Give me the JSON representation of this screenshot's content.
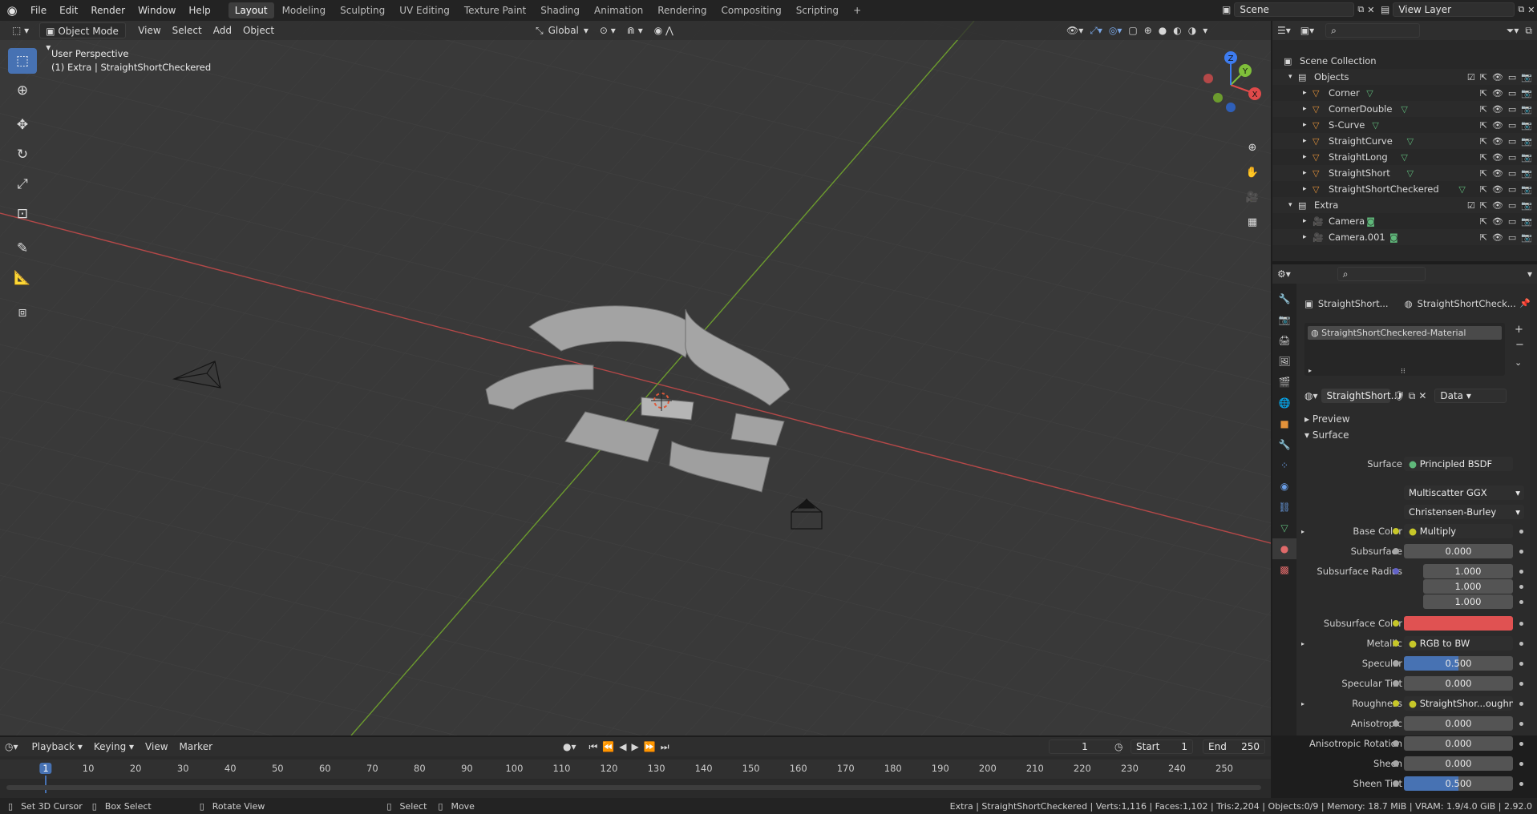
{
  "topbar": {
    "menus": [
      "File",
      "Edit",
      "Render",
      "Window",
      "Help"
    ],
    "workspaces": [
      "Layout",
      "Modeling",
      "Sculpting",
      "UV Editing",
      "Texture Paint",
      "Shading",
      "Animation",
      "Rendering",
      "Compositing",
      "Scripting"
    ],
    "active_workspace": "Layout",
    "add_workspace": "+",
    "scene": "Scene",
    "view_layer": "View Layer"
  },
  "viewport": {
    "mode": "Object Mode",
    "menus": [
      "View",
      "Select",
      "Add",
      "Object"
    ],
    "transform_orientation": "Global",
    "view_name": "User Perspective",
    "collection_object": "(1) Extra | StraightShortCheckered",
    "gizmo_axes": {
      "x": "X",
      "y": "Y",
      "z": "Z"
    }
  },
  "outliner": {
    "search_placeholder": "",
    "rows": [
      {
        "label": "Scene Collection",
        "indent": 0,
        "kind": "scene"
      },
      {
        "label": "Objects",
        "indent": 1,
        "kind": "collection"
      },
      {
        "label": "Corner",
        "indent": 2,
        "kind": "mesh"
      },
      {
        "label": "CornerDouble",
        "indent": 2,
        "kind": "mesh"
      },
      {
        "label": "S-Curve",
        "indent": 2,
        "kind": "mesh"
      },
      {
        "label": "StraightCurve",
        "indent": 2,
        "kind": "mesh"
      },
      {
        "label": "StraightLong",
        "indent": 2,
        "kind": "mesh"
      },
      {
        "label": "StraightShort",
        "indent": 2,
        "kind": "mesh"
      },
      {
        "label": "StraightShortCheckered",
        "indent": 2,
        "kind": "mesh"
      },
      {
        "label": "Extra",
        "indent": 1,
        "kind": "collection"
      },
      {
        "label": "Camera",
        "indent": 2,
        "kind": "camera"
      },
      {
        "label": "Camera.001",
        "indent": 2,
        "kind": "camera"
      }
    ]
  },
  "properties": {
    "breadcrumb_object": "StraightShort...",
    "breadcrumb_material": "StraightShortCheck...",
    "material_slot": "StraightShortCheckered-Material",
    "material_name": "StraightShort...",
    "link": "Data",
    "panels": {
      "preview": "Preview",
      "surface": "Surface"
    },
    "surface_label": "Surface",
    "surface_shader": "Principled BSDF",
    "distribution": "Multiscatter GGX",
    "subsurface_method": "Christensen-Burley",
    "fields": [
      {
        "label": "Base Color",
        "value": "Multiply",
        "type": "link",
        "expand": true
      },
      {
        "label": "Subsurface",
        "value": "0.000",
        "type": "num"
      },
      {
        "label": "Subsurface Radius",
        "value": "1.000",
        "type": "num"
      },
      {
        "label": "",
        "value": "1.000",
        "type": "num"
      },
      {
        "label": "",
        "value": "1.000",
        "type": "num"
      },
      {
        "label": "Subsurface Color",
        "value": "",
        "type": "color",
        "color": "#e05252"
      },
      {
        "label": "Metallic",
        "value": "RGB to BW",
        "type": "link",
        "expand": true
      },
      {
        "label": "Specular",
        "value": "0.500",
        "type": "slider",
        "fraction": 0.5
      },
      {
        "label": "Specular Tint",
        "value": "0.000",
        "type": "num"
      },
      {
        "label": "Roughness",
        "value": "StraightShor...oughness.pn",
        "type": "link",
        "expand": true
      },
      {
        "label": "Anisotropic",
        "value": "0.000",
        "type": "num"
      },
      {
        "label": "Anisotropic Rotation",
        "value": "0.000",
        "type": "num"
      },
      {
        "label": "Sheen",
        "value": "0.000",
        "type": "num"
      },
      {
        "label": "Sheen Tint",
        "value": "0.500",
        "type": "slider",
        "fraction": 0.5
      }
    ]
  },
  "timeline": {
    "menus": [
      "Playback",
      "Keying",
      "View",
      "Marker"
    ],
    "current_frame": "1",
    "start_label": "Start",
    "start": "1",
    "end_label": "End",
    "end": "250",
    "ticks": [
      "1",
      "10",
      "20",
      "30",
      "40",
      "50",
      "60",
      "70",
      "80",
      "90",
      "100",
      "110",
      "120",
      "130",
      "140",
      "150",
      "160",
      "170",
      "180",
      "190",
      "200",
      "210",
      "220",
      "230",
      "240",
      "250"
    ]
  },
  "statusbar": {
    "hints": [
      "Set 3D Cursor",
      "Box Select",
      "Rotate View",
      "Select",
      "Move"
    ],
    "stats": "Extra | StraightShortCheckered | Verts:1,116 | Faces:1,102 | Tris:2,204 | Objects:0/9 | Memory: 18.7 MiB | VRAM: 1.9/4.0 GiB | 2.92.0"
  },
  "colors": {
    "accent": "#4772b3",
    "x_axis": "#e04a4a",
    "y_axis": "#7fbf3a",
    "z_axis": "#3d7cf0",
    "mesh_icon": "#e3923a",
    "data_icon": "#5fb87a"
  }
}
